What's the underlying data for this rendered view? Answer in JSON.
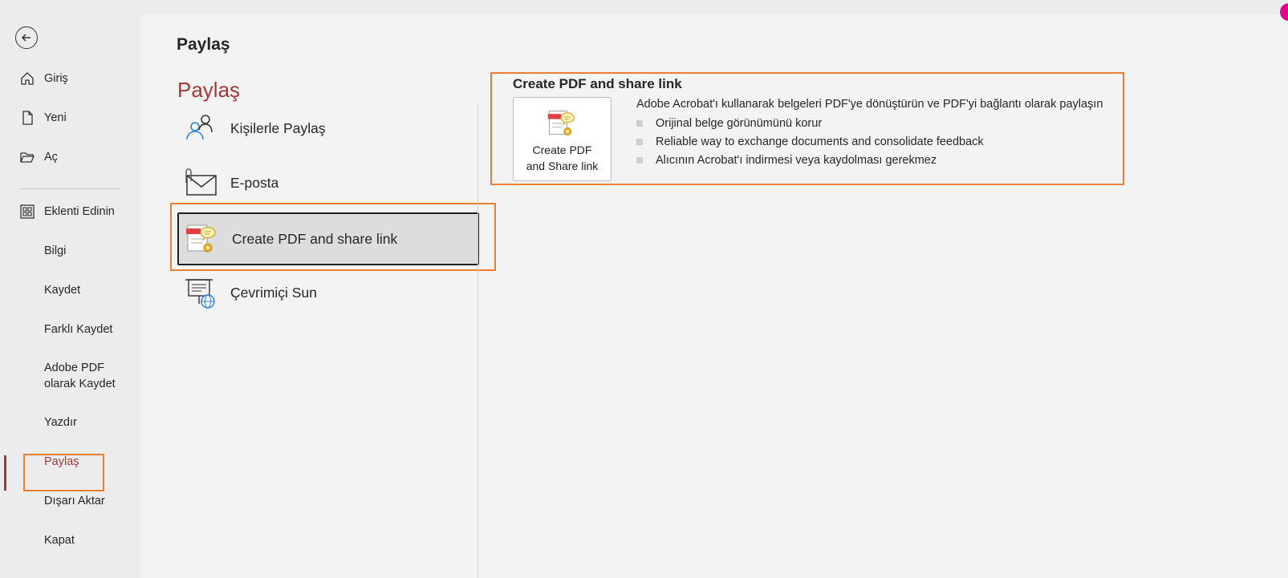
{
  "nav": {
    "items": [
      {
        "label": "Giriş",
        "icon": "home-icon"
      },
      {
        "label": "Yeni",
        "icon": "new-document-icon"
      },
      {
        "label": "Aç",
        "icon": "open-folder-icon"
      },
      {
        "label": "Eklenti Edinin",
        "icon": "add-ins-icon"
      },
      {
        "label": "Bilgi"
      },
      {
        "label": "Kaydet"
      },
      {
        "label": "Farklı Kaydet"
      },
      {
        "label": "Adobe PDF\nolarak Kaydet"
      },
      {
        "label": "Yazdır"
      },
      {
        "label": "Paylaş",
        "active": true
      },
      {
        "label": "Dışarı Aktar"
      },
      {
        "label": "Kapat"
      }
    ]
  },
  "main": {
    "page_title": "Paylaş",
    "section_title": "Paylaş",
    "options": [
      {
        "label": "Kişilerle Paylaş",
        "icon": "share-people-icon"
      },
      {
        "label": "E-posta",
        "icon": "email-attachment-icon"
      },
      {
        "label": "Create PDF and share link",
        "icon": "pdf-share-icon",
        "selected": true
      },
      {
        "label": "Çevrimiçi Sun",
        "icon": "present-online-icon"
      }
    ]
  },
  "detail": {
    "title": "Create PDF and share link",
    "button_label": "Create PDF\nand Share link",
    "description": "Adobe Acrobat'ı kullanarak belgeleri PDF'ye dönüştürün ve PDF'yi bağlantı olarak paylaşın",
    "bullets": [
      "Orijinal belge görünümünü korur",
      "Reliable way to exchange documents and consolidate feedback",
      "Alıcının Acrobat'ı indirmesi veya kaydolması gerekmez"
    ]
  },
  "colors": {
    "accent": "#a4373a",
    "highlight": "#ed7d31",
    "nav_bg": "#ececec",
    "main_bg": "#f3f3f3"
  }
}
